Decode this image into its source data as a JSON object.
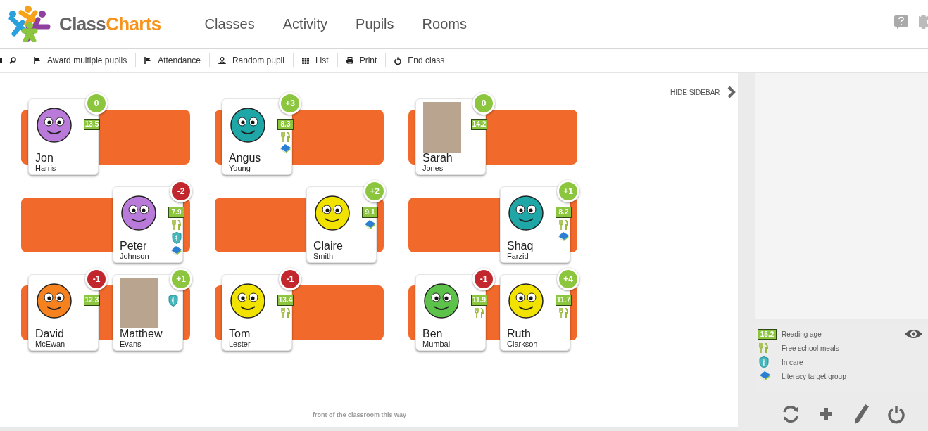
{
  "header": {
    "logo": {
      "part_1": "Class",
      "part_2": "Charts"
    },
    "nav": [
      {
        "label": "Classes"
      },
      {
        "label": "Activity"
      },
      {
        "label": "Pupils"
      },
      {
        "label": "Rooms"
      }
    ]
  },
  "toolbar": [
    {
      "kind": "flag",
      "label": "Award multiple pupils"
    },
    {
      "kind": "flag",
      "label": "Attendance"
    },
    {
      "kind": "person",
      "label": "Random pupil"
    },
    {
      "kind": "grid",
      "label": "List"
    },
    {
      "kind": "printer",
      "label": "Print"
    },
    {
      "kind": "power",
      "label": "End class"
    }
  ],
  "hide_sidebar": "HIDE SIDEBAR",
  "groups": [
    {
      "left_seat": {
        "first_name": "Jon",
        "last_name": "Harris",
        "points": "0",
        "color": "#8cc63f",
        "reading_age": "13.5",
        "avatar": {
          "kind": "cartoon",
          "color": "#b97ad9"
        },
        "free_school_meals": false,
        "in_care": false,
        "literacy_target_group": false
      }
    },
    {
      "left_seat": {
        "first_name": "Angus",
        "last_name": "Young",
        "points": "+3",
        "color": "#8cc63f",
        "reading_age": "8.3",
        "avatar": {
          "kind": "cartoon",
          "color": "#1fa7a7"
        },
        "free_school_meals": true,
        "in_care": false,
        "literacy_target_group": true
      }
    },
    {
      "left_seat": {
        "first_name": "Sarah",
        "last_name": "Jones",
        "points": "0",
        "color": "#8cc63f",
        "reading_age": "14.2",
        "avatar": {
          "kind": "photo"
        },
        "free_school_meals": false,
        "in_care": false,
        "literacy_target_group": false
      }
    },
    {
      "right_seat": {
        "first_name": "Peter",
        "last_name": "Johnson",
        "points": "-2",
        "color": "#c1272d",
        "reading_age": "7.9",
        "avatar": {
          "kind": "cartoon",
          "color": "#b97ad9"
        },
        "free_school_meals": true,
        "in_care": true,
        "literacy_target_group": true
      }
    },
    {
      "right_seat": {
        "first_name": "Claire",
        "last_name": "Smith",
        "points": "+2",
        "color": "#8cc63f",
        "reading_age": "9.1",
        "avatar": {
          "kind": "cartoon",
          "color": "#f2e200"
        },
        "free_school_meals": false,
        "in_care": false,
        "literacy_target_group": true
      }
    },
    {
      "right_seat": {
        "first_name": "Shaq",
        "last_name": "Farzid",
        "points": "+1",
        "color": "#8cc63f",
        "reading_age": "8.2",
        "avatar": {
          "kind": "cartoon",
          "color": "#1fa7a7"
        },
        "free_school_meals": true,
        "in_care": false,
        "literacy_target_group": true
      }
    },
    {
      "left_seat": {
        "first_name": "David",
        "last_name": "McEwan",
        "points": "-1",
        "color": "#c1272d",
        "reading_age": "12.3",
        "avatar": {
          "kind": "cartoon",
          "color": "#f5821f"
        },
        "free_school_meals": false,
        "in_care": false,
        "literacy_target_group": false
      },
      "right_seat": {
        "first_name": "Matthew",
        "last_name": "Evans",
        "points": "+1",
        "color": "#8cc63f",
        "avatar": {
          "kind": "photo"
        },
        "free_school_meals": false,
        "in_care": true,
        "literacy_target_group": false
      }
    },
    {
      "left_seat": {
        "first_name": "Tom",
        "last_name": "Lester",
        "points": "-1",
        "color": "#c1272d",
        "reading_age": "13.4",
        "avatar": {
          "kind": "cartoon",
          "color": "#f2e200"
        },
        "free_school_meals": true,
        "in_care": false,
        "literacy_target_group": false
      }
    },
    {
      "left_seat": {
        "first_name": "Ben",
        "last_name": "Mumbai",
        "points": "-1",
        "color": "#c1272d",
        "reading_age": "11.9",
        "avatar": {
          "kind": "cartoon",
          "color": "#5cc24a"
        },
        "free_school_meals": true,
        "in_care": false,
        "literacy_target_group": false
      },
      "right_seat": {
        "first_name": "Ruth",
        "last_name": "Clarkson",
        "points": "+4",
        "color": "#8cc63f",
        "reading_age": "11.7",
        "avatar": {
          "kind": "cartoon",
          "color": "#f2e200"
        },
        "free_school_meals": true,
        "in_care": false,
        "literacy_target_group": false
      }
    }
  ],
  "front_label": "front of the classroom this way",
  "legend": [
    {
      "kind": "reading_age",
      "badge": "15.2",
      "label": "Reading age"
    },
    {
      "kind": "free_school_meals",
      "label": "Free school meals"
    },
    {
      "kind": "in_care",
      "label": "In care"
    },
    {
      "kind": "literacy_target_group",
      "label": "Literacy target group"
    }
  ]
}
